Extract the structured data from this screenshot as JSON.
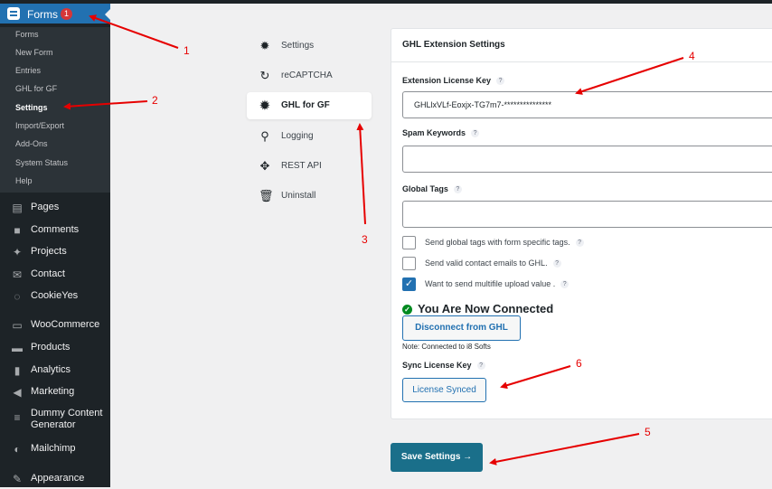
{
  "sidebar": {
    "forms_label": "Forms",
    "forms_badge": "1",
    "submenu": [
      "Forms",
      "New Form",
      "Entries",
      "GHL for GF",
      "Settings",
      "Import/Export",
      "Add-Ons",
      "System Status",
      "Help"
    ],
    "active_submenu": "Settings",
    "menu": [
      {
        "label": "Pages",
        "icon": "pages-icon"
      },
      {
        "label": "Comments",
        "icon": "comments-icon"
      },
      {
        "label": "Projects",
        "icon": "pin-icon"
      },
      {
        "label": "Contact",
        "icon": "mail-icon"
      },
      {
        "label": "CookieYes",
        "icon": "cookie-icon"
      },
      {
        "label": "WooCommerce",
        "icon": "woo-icon"
      },
      {
        "label": "Products",
        "icon": "archive-icon"
      },
      {
        "label": "Analytics",
        "icon": "bar-chart-icon"
      },
      {
        "label": "Marketing",
        "icon": "megaphone-icon"
      },
      {
        "label": "Dummy Content Generator",
        "icon": "database-icon"
      },
      {
        "label": "Mailchimp",
        "icon": "mailchimp-icon"
      },
      {
        "label": "Appearance",
        "icon": "brush-icon"
      }
    ]
  },
  "settings_nav": [
    {
      "label": "Settings",
      "icon": "gear-icon"
    },
    {
      "label": "reCAPTCHA",
      "icon": "recaptcha-icon"
    },
    {
      "label": "GHL for GF",
      "icon": "gear-icon"
    },
    {
      "label": "Logging",
      "icon": "search-icon"
    },
    {
      "label": "REST API",
      "icon": "api-icon"
    },
    {
      "label": "Uninstall",
      "icon": "trash-icon"
    }
  ],
  "panel": {
    "title": "GHL Extension Settings",
    "license_label": "Extension License Key",
    "license_value": "GHLlxVLf-Eoxjx-TG7m7-***************",
    "spam_label": "Spam Keywords",
    "spam_value": "",
    "tags_label": "Global Tags",
    "tags_value": "",
    "help_glyph": "?",
    "checkboxes": [
      {
        "label": "Send global tags with form specific tags.",
        "checked": false
      },
      {
        "label": "Send valid contact emails to GHL.",
        "checked": false
      },
      {
        "label": "Want to send multifile upload value .",
        "checked": true
      }
    ],
    "connected_text": "You Are Now Connected",
    "disconnect_label": "Disconnect from GHL",
    "note_text": "Note: Connected to i8 Softs",
    "sync_label": "Sync License Key",
    "sync_button": "License Synced"
  },
  "save_button": "Save Settings →",
  "annotations": [
    "1",
    "2",
    "3",
    "4",
    "5",
    "6"
  ],
  "colors": {
    "accent": "#2271b1",
    "save": "#1a6f8a",
    "annotation": "#e60000",
    "sidebar": "#1d2327"
  }
}
